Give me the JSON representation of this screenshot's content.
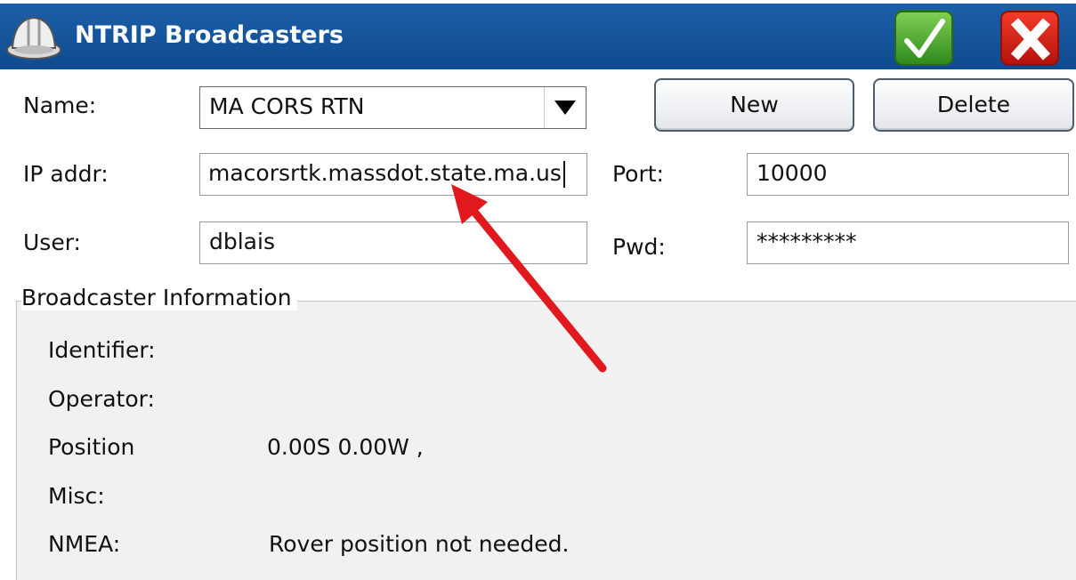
{
  "window": {
    "title": "NTRIP Broadcasters",
    "ok_icon": "checkmark-icon",
    "cancel_icon": "x-close-icon",
    "app_icon": "hard-hat-icon",
    "title_bar_color": "#0e4b8f"
  },
  "form": {
    "name_label": "Name:",
    "name_value": "MA CORS RTN",
    "ip_label": "IP addr:",
    "ip_value": "macorsrtk.massdot.state.ma.us",
    "port_label": "Port:",
    "port_value": "10000",
    "user_label": "User:",
    "user_value": "dblais",
    "pwd_label": "Pwd:",
    "pwd_value": "*********"
  },
  "buttons": {
    "new_label": "New",
    "delete_label": "Delete"
  },
  "broadcaster_info": {
    "heading": "Broadcaster Information",
    "identifier_label": "Identifier:",
    "operator_label": "Operator:",
    "position_label": "Position",
    "position_value": "0.00S 0.00W ,",
    "misc_label": "Misc:",
    "nmea_label": "NMEA:",
    "nmea_value": "Rover position not needed."
  },
  "annotation": {
    "arrow_color": "#e0191e"
  }
}
